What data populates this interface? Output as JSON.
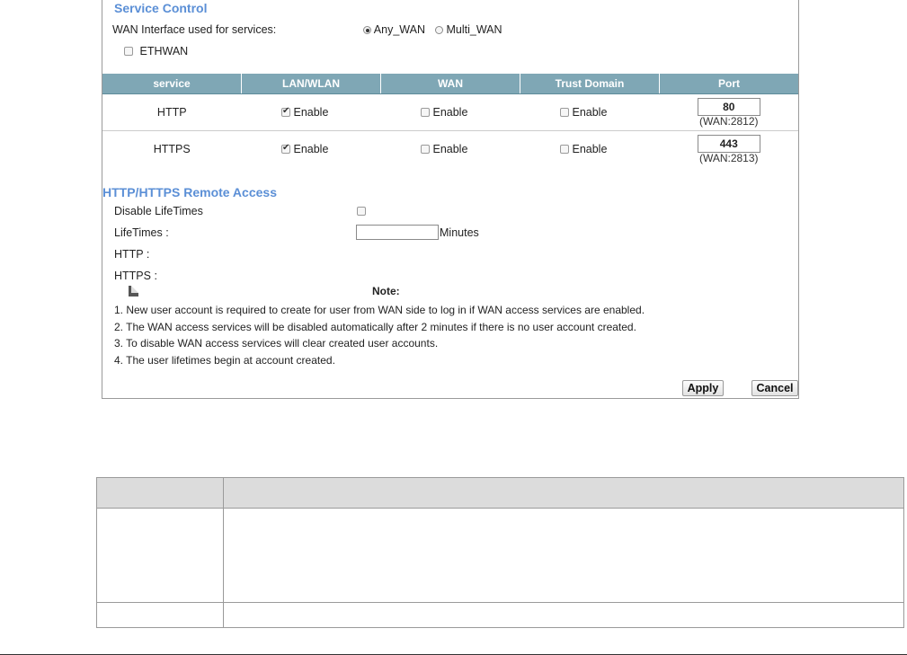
{
  "service_control": {
    "title": "Service Control",
    "wan_interface_label": "WAN Interface used for services:",
    "wan_options": [
      {
        "label": "Any_WAN",
        "selected": true
      },
      {
        "label": "Multi_WAN",
        "selected": false
      }
    ],
    "ethwan_label": "ETHWAN",
    "table": {
      "headers": [
        "service",
        "LAN/WLAN",
        "WAN",
        "Trust Domain",
        "Port"
      ],
      "rows": [
        {
          "service": "HTTP",
          "lan": {
            "label": "Enable",
            "checked": true
          },
          "wan": {
            "label": "Enable",
            "checked": false
          },
          "trust": {
            "label": "Enable",
            "checked": false
          },
          "port": "80",
          "port_wan": "(WAN:2812)"
        },
        {
          "service": "HTTPS",
          "lan": {
            "label": "Enable",
            "checked": true
          },
          "wan": {
            "label": "Enable",
            "checked": false
          },
          "trust": {
            "label": "Enable",
            "checked": false
          },
          "port": "443",
          "port_wan": "(WAN:2813)"
        }
      ]
    }
  },
  "remote_access": {
    "title": "HTTP/HTTPS Remote Access",
    "disable_lifetimes_label": "Disable LifeTimes",
    "lifetimes_label": "LifeTimes :",
    "lifetimes_value": "",
    "lifetimes_unit": "Minutes",
    "http_label": "HTTP :",
    "https_label": "HTTPS :"
  },
  "note": {
    "title": "Note:",
    "lines": [
      "1. New user account is required to create for user from WAN side to log in if WAN access services are enabled.",
      "2. The WAN access services will be disabled automatically after 2 minutes if there is no user account created.",
      "3. To disable WAN access services will clear created user accounts.",
      "4. The user lifetimes begin at account created."
    ]
  },
  "buttons": {
    "apply": "Apply",
    "cancel": "Cancel"
  }
}
